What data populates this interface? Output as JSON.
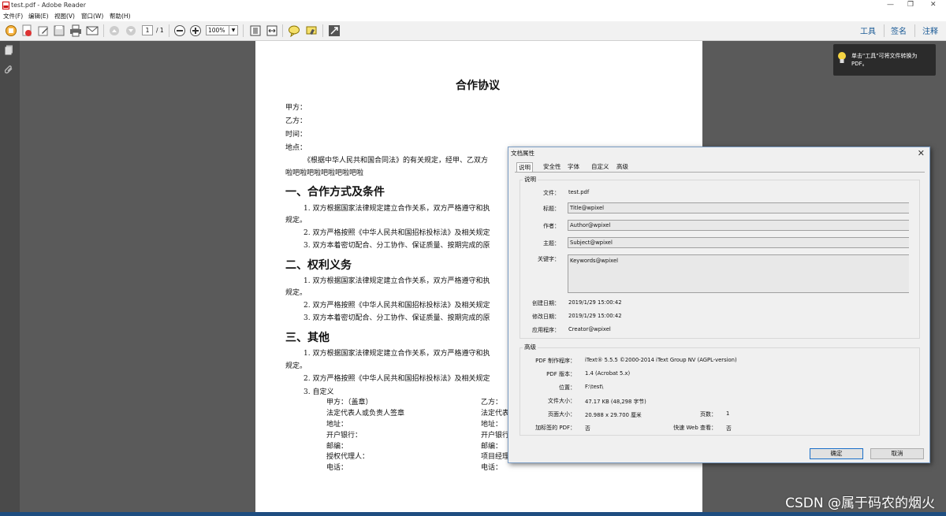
{
  "window": {
    "title": "test.pdf - Adobe Reader"
  },
  "menu": [
    "文件(F)",
    "编辑(E)",
    "视图(V)",
    "窗口(W)",
    "帮助(H)"
  ],
  "toolbar": {
    "page_current": "1",
    "page_total": "/ 1",
    "zoom": "100%",
    "right_tabs": [
      "工具",
      "签名",
      "注释"
    ]
  },
  "tooltip": {
    "text": "单击\"工具\"可将文件转换为 PDF。"
  },
  "document": {
    "title": "合作协议",
    "fields": [
      "甲方：",
      "乙方：",
      "时间：",
      "地点："
    ],
    "intro_line1": "《根据中华人民共和国合同法》的有关规定，经甲、乙双方",
    "intro_line2": "啦吧啦吧啦吧啦吧啦吧啦",
    "sections": [
      {
        "heading": "一、合作方式及条件",
        "items": [
          "1. 双方根据国家法律规定建立合作关系，双方严格遵守和执",
          "规定。",
          "2. 双方严格按照《中华人民共和国招标投标法》及相关规定",
          "3. 双方本着密切配合、分工协作、保证质量、按期完成的原"
        ]
      },
      {
        "heading": "二、权利义务",
        "items": [
          "1. 双方根据国家法律规定建立合作关系，双方严格遵守和执",
          "规定。",
          "2. 双方严格按照《中华人民共和国招标投标法》及相关规定",
          "3. 双方本着密切配合、分工协作、保证质量、按期完成的原"
        ]
      },
      {
        "heading": "三、其他",
        "items": [
          "1. 双方根据国家法律规定建立合作关系，双方严格遵守和执",
          "规定。",
          "2. 双方严格按照《中华人民共和国招标投标法》及相关规定",
          "3. 自定义"
        ]
      }
    ],
    "sign_left": [
      "甲方：（盖章）",
      "法定代表人或负责人签章",
      "地址：",
      "开户银行：",
      "邮编：",
      "授权代理人：",
      "电话："
    ],
    "sign_right": [
      "乙方：",
      "法定代表",
      "地址：",
      "开户银行",
      "邮编：",
      "项目经理",
      "电话："
    ]
  },
  "dialog": {
    "title": "文档属性",
    "tabs": [
      "说明",
      "安全性",
      "字体",
      "自定义",
      "高级"
    ],
    "desc_group": "说明",
    "file_label": "文件：",
    "file_value": "test.pdf",
    "title_label": "标题：",
    "title_value": "Title@wpixel",
    "author_label": "作者：",
    "author_value": "Author@wpixel",
    "subject_label": "主题：",
    "subject_value": "Subject@wpixel",
    "keywords_label": "关键字：",
    "keywords_value": "Keywords@wpixel",
    "created_label": "创建日期：",
    "created_value": "2019/1/29 15:00:42",
    "modified_label": "修改日期：",
    "modified_value": "2019/1/29 15:00:42",
    "app_label": "应用程序：",
    "app_value": "Creator@wpixel",
    "adv_group": "高级",
    "producer_label": "PDF 制作程序：",
    "producer_value": "iText® 5.5.5 ©2000-2014 iText Group NV (AGPL-version)",
    "version_label": "PDF 版本：",
    "version_value": "1.4 (Acrobat 5.x)",
    "location_label": "位置：",
    "location_value": "F:\\test\\",
    "size_label": "文件大小：",
    "size_value": "47.17 KB (48,298 字节)",
    "pagesize_label": "页面大小：",
    "pagesize_value": "20.988 x 29.700 厘米",
    "pages_label": "页数：",
    "pages_value": "1",
    "tagged_label": "加标签的 PDF：",
    "tagged_value": "否",
    "fastweb_label": "快速 Web 查看：",
    "fastweb_value": "否",
    "ok": "确定",
    "cancel": "取消"
  },
  "watermark": "CSDN @属于码农的烟火"
}
